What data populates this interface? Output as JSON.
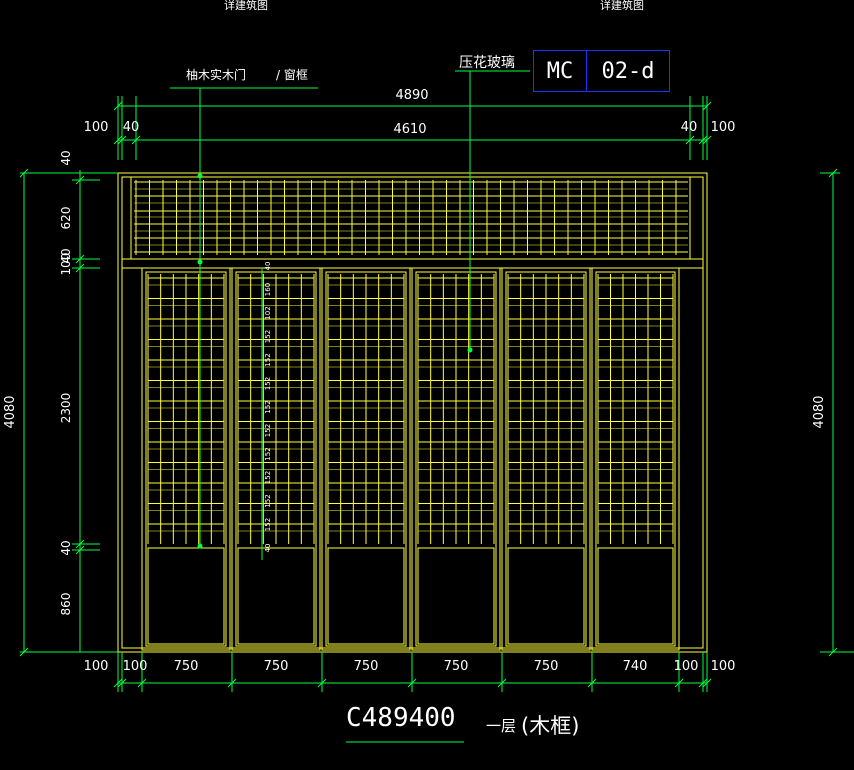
{
  "header": {
    "left_label": "详建筑图",
    "right_label": "详建筑图"
  },
  "labels": {
    "frame_material": "柚木实木门",
    "frame_material_sep": "/ 窗框",
    "glass": "压花玻璃"
  },
  "tag": {
    "type": "MC",
    "number": "02-d"
  },
  "dims": {
    "overall_width": "4890",
    "inner_width": "4610",
    "side_margin": "100",
    "frame_40": "40",
    "overall_height": "4080",
    "heights": [
      "40",
      "620",
      "40",
      "100",
      "2300",
      "40",
      "860"
    ],
    "bottom": [
      "100",
      "100",
      "750",
      "750",
      "750",
      "750",
      "750",
      "740",
      "100",
      "100"
    ]
  },
  "grid_labels": [
    "40",
    "160",
    "102",
    "152",
    "152",
    "152",
    "152",
    "152",
    "152",
    "152",
    "152",
    "152",
    "40"
  ],
  "footer": {
    "code": "C489400",
    "floor": "一层",
    "note": "(木框)"
  },
  "colors": {
    "frame": "#ffff3c",
    "dim": "#00ff44",
    "tag_border": "#1a33ff",
    "bg": "#000000"
  }
}
